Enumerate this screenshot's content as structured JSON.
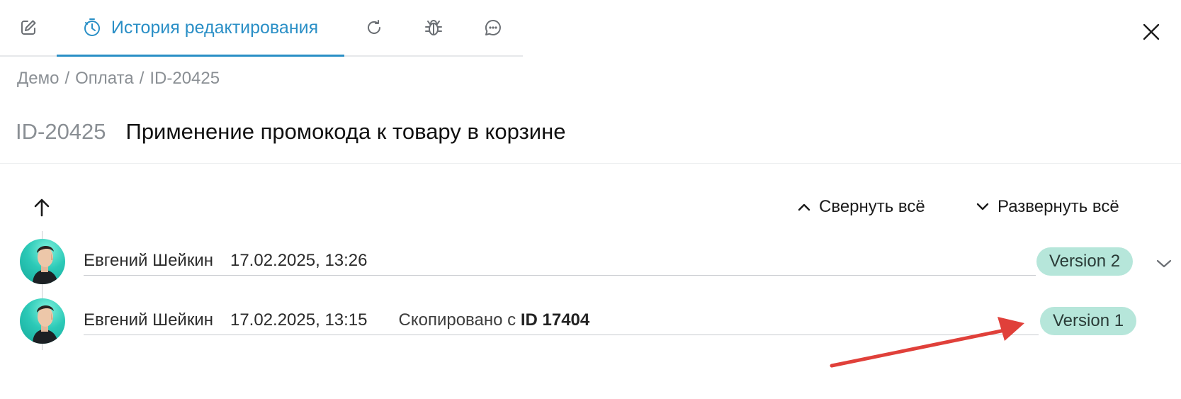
{
  "tabs": {
    "edit_icon": "edit-icon",
    "history_label": "История редактирования",
    "history_icon": "history-timer-icon",
    "refresh_icon": "refresh-icon",
    "bug_icon": "bug-icon",
    "chat_icon": "chat-icon",
    "accent_color": "#2a8fc6"
  },
  "close_icon": "close-icon",
  "breadcrumb": {
    "items": [
      "Демо",
      "Оплата",
      "ID-20425"
    ],
    "separator": "/"
  },
  "header": {
    "id": "ID-20425",
    "title": "Применение промокода к товару в корзине"
  },
  "controls": {
    "sort_icon": "arrow-up-icon",
    "collapse_all": "Свернуть всё",
    "expand_all": "Развернуть всё"
  },
  "history": [
    {
      "author": "Евгений Шейкин",
      "date": "17.02.2025, 13:26",
      "copied_prefix": "",
      "copied_id": "",
      "version": "Version 2",
      "expandable": true
    },
    {
      "author": "Евгений Шейкин",
      "date": "17.02.2025, 13:15",
      "copied_prefix": "Скопировано с",
      "copied_id": "ID 17404",
      "version": "Version 1",
      "expandable": false
    }
  ],
  "colors": {
    "badge_bg": "#b6e6da",
    "annotation_arrow": "#e0403a"
  }
}
